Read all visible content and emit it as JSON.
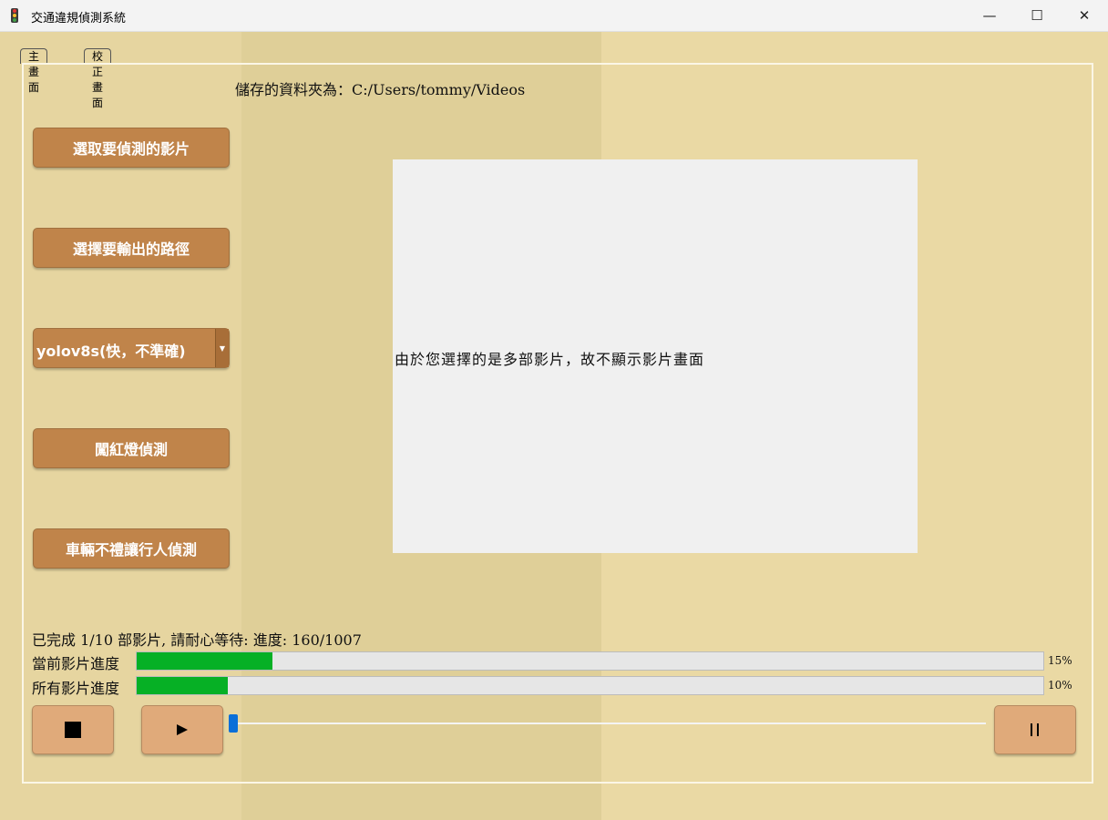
{
  "window": {
    "title": "交通違規偵測系統",
    "minimize": "—",
    "maximize": "☐",
    "close": "✕"
  },
  "tabs": [
    {
      "label": "主畫面"
    },
    {
      "label": "校正畫面"
    }
  ],
  "folder": {
    "label": "儲存的資料夾為：C:/Users/tommy/Videos"
  },
  "buttons": {
    "select_video": "選取要偵測的影片",
    "select_output": "選擇要輸出的路徑",
    "red_light": "闖紅燈偵測",
    "pedestrian": "車輛不禮讓行人偵測"
  },
  "model_select": {
    "selected": "yolov8s(快，不準確)",
    "arrow": "▼"
  },
  "video": {
    "message": "由於您選擇的是多部影片，故不顯示影片畫面"
  },
  "status": {
    "text": "已完成 1/10 部影片, 請耐心等待: 進度: 160/1007"
  },
  "progress": {
    "current_label": "當前影片進度",
    "current_value": 0.15,
    "current_pct": "15%",
    "all_label": "所有影片進度",
    "all_value": 0.1,
    "all_pct": "10%"
  },
  "playback": {
    "position": 0.0
  },
  "colors": {
    "accent_button": "#c0844a",
    "control_button": "#e0aa7a",
    "progress_fill": "#06b025",
    "slider_handle": "#0a6fd8",
    "background": "#e6d5a0"
  }
}
